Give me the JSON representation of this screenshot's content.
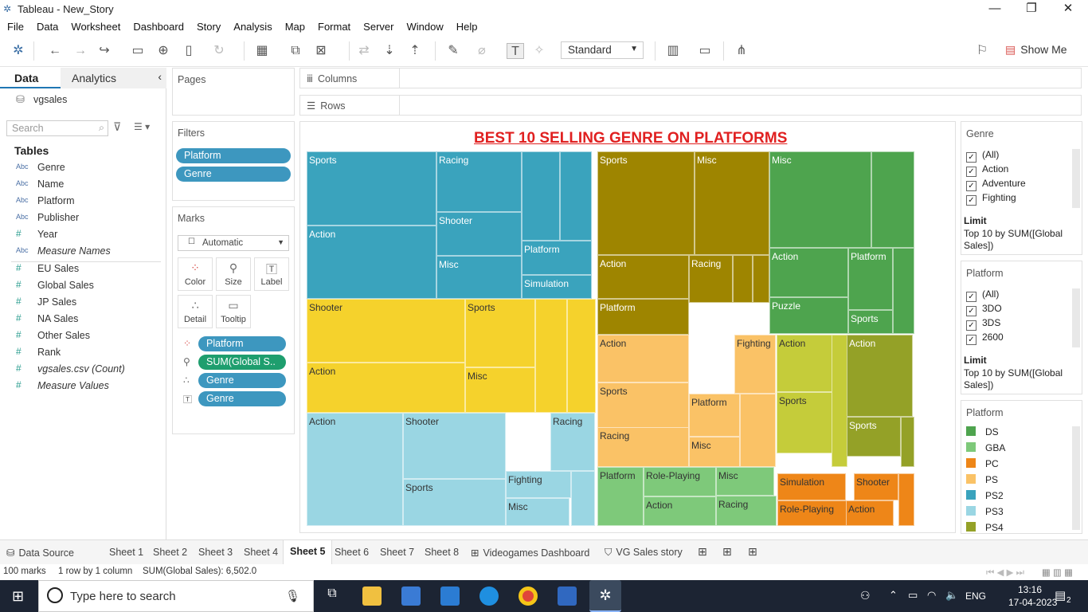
{
  "window": {
    "title": "Tableau - New_Story"
  },
  "menu": [
    "File",
    "Data",
    "Worksheet",
    "Dashboard",
    "Story",
    "Analysis",
    "Map",
    "Format",
    "Server",
    "Window",
    "Help"
  ],
  "toolbar": {
    "fit": "Standard",
    "show_me": "Show Me"
  },
  "left": {
    "tab_data": "Data",
    "tab_analytics": "Analytics",
    "source": "vgsales",
    "search_placeholder": "Search",
    "tables_header": "Tables",
    "fields": [
      {
        "type": "Abc",
        "name": "Genre",
        "italic": false
      },
      {
        "type": "Abc",
        "name": "Name",
        "italic": false
      },
      {
        "type": "Abc",
        "name": "Platform",
        "italic": false
      },
      {
        "type": "Abc",
        "name": "Publisher",
        "italic": false
      },
      {
        "type": "#",
        "name": "Year",
        "italic": false
      },
      {
        "type": "Abc",
        "name": "Measure Names",
        "italic": true
      },
      {
        "type": "#",
        "name": "EU Sales",
        "italic": false
      },
      {
        "type": "#",
        "name": "Global Sales",
        "italic": false
      },
      {
        "type": "#",
        "name": "JP Sales",
        "italic": false
      },
      {
        "type": "#",
        "name": "NA Sales",
        "italic": false
      },
      {
        "type": "#",
        "name": "Other Sales",
        "italic": false
      },
      {
        "type": "#",
        "name": "Rank",
        "italic": false
      },
      {
        "type": "#",
        "name": "vgsales.csv (Count)",
        "italic": true
      },
      {
        "type": "#",
        "name": "Measure Values",
        "italic": true
      }
    ]
  },
  "pages": {
    "header": "Pages"
  },
  "filters": {
    "header": "Filters",
    "pills": [
      "Platform",
      "Genre"
    ]
  },
  "marks": {
    "header": "Marks",
    "type": "Automatic",
    "buttons": [
      "Color",
      "Size",
      "Label",
      "Detail",
      "Tooltip"
    ],
    "pills": [
      "Platform",
      "SUM(Global S..",
      "Genre",
      "Genre"
    ]
  },
  "shelves": {
    "columns": "Columns",
    "rows": "Rows"
  },
  "viz": {
    "title": "BEST 10 SELLING GENRE ON PLATFORMS"
  },
  "treemap": [
    {
      "label": "Sports",
      "color": "#3aa3bd"
    },
    {
      "label": "Racing",
      "color": "#3aa3bd"
    },
    {
      "label": "Action",
      "color": "#3aa3bd"
    },
    {
      "label": "Shooter",
      "color": "#3aa3bd"
    },
    {
      "label": "Misc",
      "color": "#3aa3bd"
    },
    {
      "label": "Platform",
      "color": "#3aa3bd"
    },
    {
      "label": "Simulation",
      "color": "#3aa3bd"
    },
    {
      "label": "",
      "color": "#3aa3bd"
    },
    {
      "label": "",
      "color": "#3aa3bd"
    },
    {
      "label": "Sports",
      "color": "#9e8500"
    },
    {
      "label": "Misc",
      "color": "#9e8500"
    },
    {
      "label": "Action",
      "color": "#9e8500"
    },
    {
      "label": "Racing",
      "color": "#9e8500"
    },
    {
      "label": "Platform",
      "color": "#9e8500"
    },
    {
      "label": "",
      "color": "#9e8500"
    },
    {
      "label": "",
      "color": "#9e8500"
    },
    {
      "label": "Misc",
      "color": "#4ea44e"
    },
    {
      "label": "Action",
      "color": "#4ea44e"
    },
    {
      "label": "Platform",
      "color": "#4ea44e"
    },
    {
      "label": "Puzzle",
      "color": "#4ea44e"
    },
    {
      "label": "Sports",
      "color": "#4ea44e"
    },
    {
      "label": "",
      "color": "#4ea44e"
    },
    {
      "label": "",
      "color": "#4ea44e"
    },
    {
      "label": "Shooter",
      "color": "#f5d22c"
    },
    {
      "label": "Sports",
      "color": "#f5d22c"
    },
    {
      "label": "Action",
      "color": "#f5d22c"
    },
    {
      "label": "Misc",
      "color": "#f5d22c"
    },
    {
      "label": "",
      "color": "#f5d22c"
    },
    {
      "label": "",
      "color": "#f5d22c"
    },
    {
      "label": "Action",
      "color": "#fac266"
    },
    {
      "label": "Fighting",
      "color": "#fac266"
    },
    {
      "label": "Sports",
      "color": "#fac266"
    },
    {
      "label": "Platform",
      "color": "#fac266"
    },
    {
      "label": "Racing",
      "color": "#fac266"
    },
    {
      "label": "Misc",
      "color": "#fac266"
    },
    {
      "label": "",
      "color": "#fac266"
    },
    {
      "label": "Action",
      "color": "#c5cc3a"
    },
    {
      "label": "Sports",
      "color": "#c5cc3a"
    },
    {
      "label": "",
      "color": "#c5cc3a"
    },
    {
      "label": "Action",
      "color": "#94a127"
    },
    {
      "label": "Sports",
      "color": "#94a127"
    },
    {
      "label": "",
      "color": "#94a127"
    },
    {
      "label": "Action",
      "color": "#9ad6e3"
    },
    {
      "label": "Shooter",
      "color": "#9ad6e3"
    },
    {
      "label": "Racing",
      "color": "#9ad6e3"
    },
    {
      "label": "Sports",
      "color": "#9ad6e3"
    },
    {
      "label": "Fighting",
      "color": "#9ad6e3"
    },
    {
      "label": "Misc",
      "color": "#9ad6e3"
    },
    {
      "label": "",
      "color": "#9ad6e3"
    },
    {
      "label": "Platform",
      "color": "#7ec97a"
    },
    {
      "label": "Role-Playing",
      "color": "#7ec97a"
    },
    {
      "label": "Misc",
      "color": "#7ec97a"
    },
    {
      "label": "Action",
      "color": "#7ec97a"
    },
    {
      "label": "Racing",
      "color": "#7ec97a"
    },
    {
      "label": "Simulation",
      "color": "#ee8618"
    },
    {
      "label": "Shooter",
      "color": "#ee8618"
    },
    {
      "label": "Role-Playing",
      "color": "#ee8618"
    },
    {
      "label": "Action",
      "color": "#ee8618"
    },
    {
      "label": "",
      "color": "#ee8618"
    }
  ],
  "genre_filter": {
    "header": "Genre",
    "items": [
      "(All)",
      "Action",
      "Adventure",
      "Fighting"
    ],
    "limit_label": "Limit",
    "limit_text": "Top 10 by SUM([Global Sales])"
  },
  "platform_filter": {
    "header": "Platform",
    "items": [
      "(All)",
      "3DO",
      "3DS",
      "2600"
    ],
    "limit_label": "Limit",
    "limit_text": "Top 10 by SUM([Global Sales])"
  },
  "platform_legend": {
    "header": "Platform",
    "items": [
      {
        "name": "DS",
        "color": "#4ea44e"
      },
      {
        "name": "GBA",
        "color": "#7ec97a"
      },
      {
        "name": "PC",
        "color": "#ee8618"
      },
      {
        "name": "PS",
        "color": "#fac266"
      },
      {
        "name": "PS2",
        "color": "#3aa3bd"
      },
      {
        "name": "PS3",
        "color": "#9ad6e3"
      },
      {
        "name": "PS4",
        "color": "#94a127"
      }
    ]
  },
  "sheets": [
    "Data Source",
    "Sheet 1",
    "Sheet 2",
    "Sheet 3",
    "Sheet 4",
    "Sheet 5",
    "Sheet 6",
    "Sheet 7",
    "Sheet 8",
    "Videogames Dashboard",
    "VG Sales story"
  ],
  "active_sheet": "Sheet 5",
  "status": {
    "marks": "100 marks",
    "rows": "1 row by 1 column",
    "sum": "SUM(Global Sales): 6,502.0"
  },
  "taskbar": {
    "search_placeholder": "Type here to search",
    "time": "13:16",
    "date": "17-04-2023",
    "lang": "ENG",
    "notif": "2"
  }
}
